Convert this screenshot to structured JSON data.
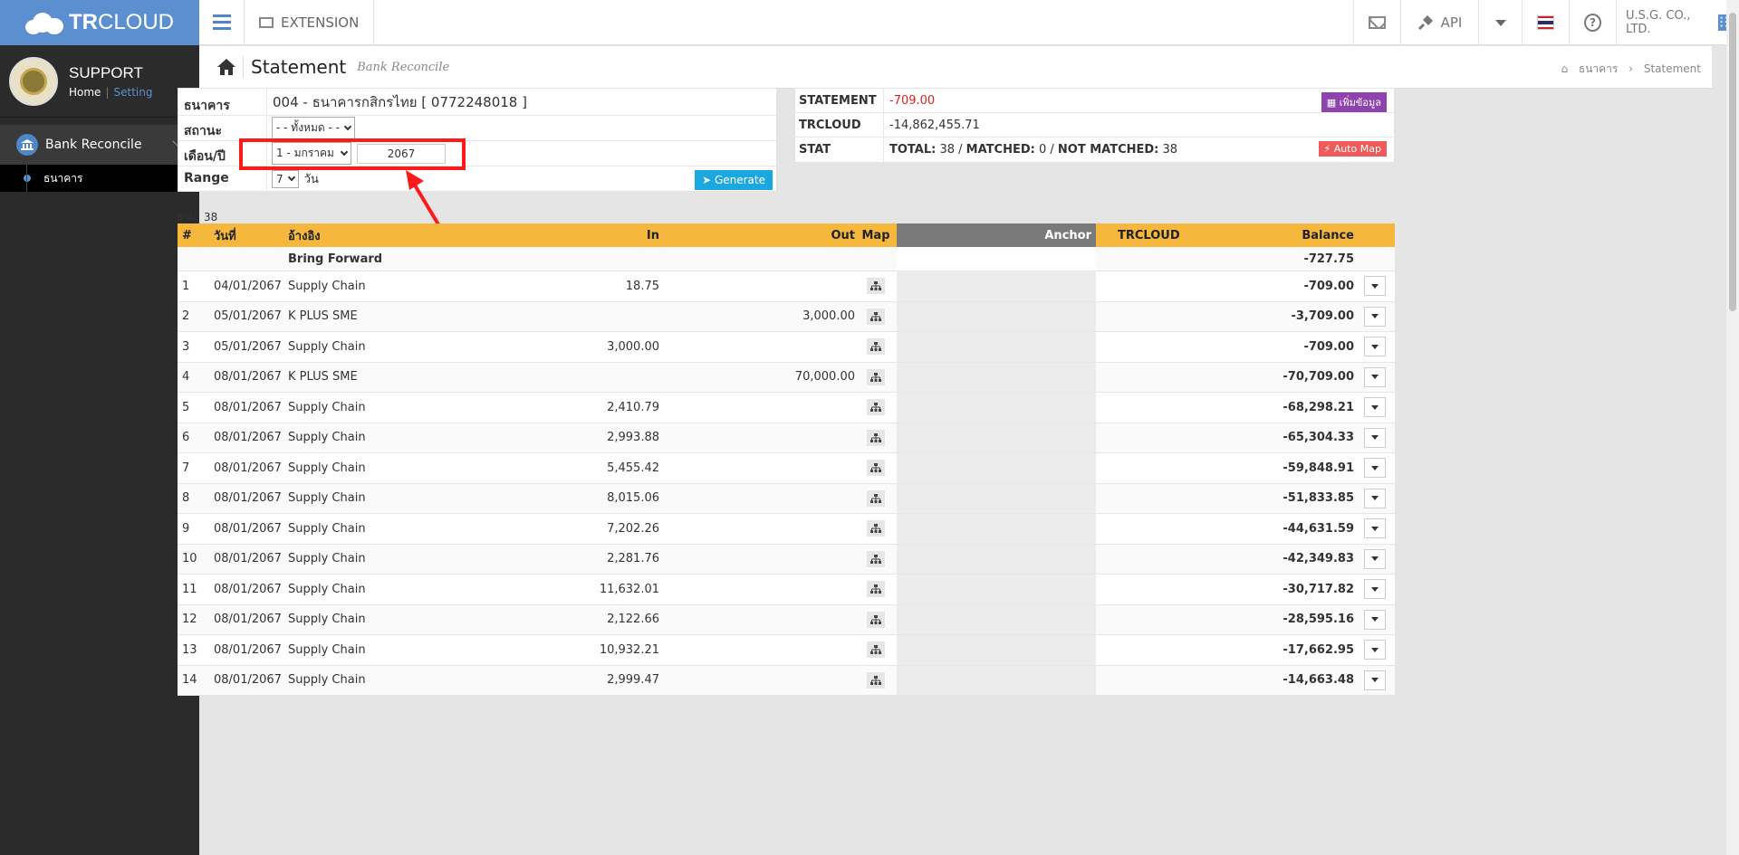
{
  "app": {
    "brand_bold": "TR",
    "brand_light": "CLOUD"
  },
  "user": {
    "name": "SUPPORT",
    "home": "Home",
    "setting": "Setting"
  },
  "sidebar": {
    "menu_label": "Bank Reconcile",
    "submenu_label": "ธนาคาร"
  },
  "topbar": {
    "extension": "EXTENSION",
    "api": "API",
    "company": "U.S.G. CO., LTD."
  },
  "page": {
    "title": "Statement",
    "subtitle": "Bank Reconcile",
    "crumb_1": "ธนาคาร",
    "crumb_sep": "›",
    "crumb_2": "Statement"
  },
  "form": {
    "bank_label": "ธนาคาร",
    "bank_value": "004 - ธนาคารกสิกรไทย [ 0772248018 ]",
    "status_label": "สถานะ",
    "status_value": "- - ทั้งหมด - -",
    "month_label": "เดือน/ปี",
    "month_value": "1 - มกราคม",
    "year_value": "2067",
    "range_label": "Range",
    "range_value": "7",
    "range_unit": "วัน",
    "generate": "Generate"
  },
  "statement": {
    "statement_label": "STATEMENT",
    "statement_value": "-709.00",
    "add_button": "เพิ่มข้อมูล",
    "trcloud_label": "TRCLOUD",
    "trcloud_value": "-14,862,455.71",
    "stat_label": "STAT",
    "stat_total_label": "TOTAL:",
    "stat_total": "38",
    "stat_matched_label": "MATCHED:",
    "stat_matched": "0",
    "stat_not_label": "NOT MATCHED:",
    "stat_not": "38",
    "automap": "Auto Map",
    "colors": {
      "red_button": "#ef5a5a",
      "purple_button": "#8e44ad"
    }
  },
  "total": "รวม: 38",
  "table": {
    "headers": {
      "no": "#",
      "date": "วันที่",
      "ref": "อ้างอิง",
      "in": "In",
      "out": "Out",
      "map": "Map",
      "anchor": "Anchor",
      "trcloud": "TRCLOUD",
      "balance": "Balance"
    },
    "bring_forward": {
      "label": "Bring Forward",
      "balance": "-727.75"
    },
    "rows": [
      {
        "no": "1",
        "date": "04/01/2067",
        "ref": "Supply Chain",
        "in": "18.75",
        "out": "",
        "balance": "-709.00"
      },
      {
        "no": "2",
        "date": "05/01/2067",
        "ref": "K PLUS SME",
        "in": "",
        "out": "3,000.00",
        "balance": "-3,709.00"
      },
      {
        "no": "3",
        "date": "05/01/2067",
        "ref": "Supply Chain",
        "in": "3,000.00",
        "out": "",
        "balance": "-709.00"
      },
      {
        "no": "4",
        "date": "08/01/2067",
        "ref": "K PLUS SME",
        "in": "",
        "out": "70,000.00",
        "balance": "-70,709.00"
      },
      {
        "no": "5",
        "date": "08/01/2067",
        "ref": "Supply Chain",
        "in": "2,410.79",
        "out": "",
        "balance": "-68,298.21"
      },
      {
        "no": "6",
        "date": "08/01/2067",
        "ref": "Supply Chain",
        "in": "2,993.88",
        "out": "",
        "balance": "-65,304.33"
      },
      {
        "no": "7",
        "date": "08/01/2067",
        "ref": "Supply Chain",
        "in": "5,455.42",
        "out": "",
        "balance": "-59,848.91"
      },
      {
        "no": "8",
        "date": "08/01/2067",
        "ref": "Supply Chain",
        "in": "8,015.06",
        "out": "",
        "balance": "-51,833.85"
      },
      {
        "no": "9",
        "date": "08/01/2067",
        "ref": "Supply Chain",
        "in": "7,202.26",
        "out": "",
        "balance": "-44,631.59"
      },
      {
        "no": "10",
        "date": "08/01/2067",
        "ref": "Supply Chain",
        "in": "2,281.76",
        "out": "",
        "balance": "-42,349.83"
      },
      {
        "no": "11",
        "date": "08/01/2067",
        "ref": "Supply Chain",
        "in": "11,632.01",
        "out": "",
        "balance": "-30,717.82"
      },
      {
        "no": "12",
        "date": "08/01/2067",
        "ref": "Supply Chain",
        "in": "2,122.66",
        "out": "",
        "balance": "-28,595.16"
      },
      {
        "no": "13",
        "date": "08/01/2067",
        "ref": "Supply Chain",
        "in": "10,932.21",
        "out": "",
        "balance": "-17,662.95"
      },
      {
        "no": "14",
        "date": "08/01/2067",
        "ref": "Supply Chain",
        "in": "2,999.47",
        "out": "",
        "balance": "-14,663.48"
      }
    ]
  }
}
